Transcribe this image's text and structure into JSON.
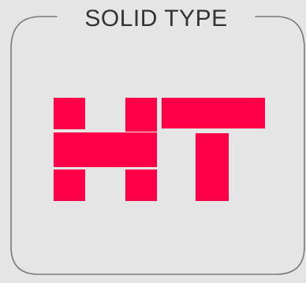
{
  "card": {
    "heading": "SOLID TYPE",
    "logo_letters": "HT"
  },
  "colors": {
    "background": "#e5e5e5",
    "border": "#7a7a7a",
    "heading_text": "#333333",
    "logo_fill": "#ff0048"
  },
  "icons": {
    "logo": "block-letters-ht-logo"
  }
}
